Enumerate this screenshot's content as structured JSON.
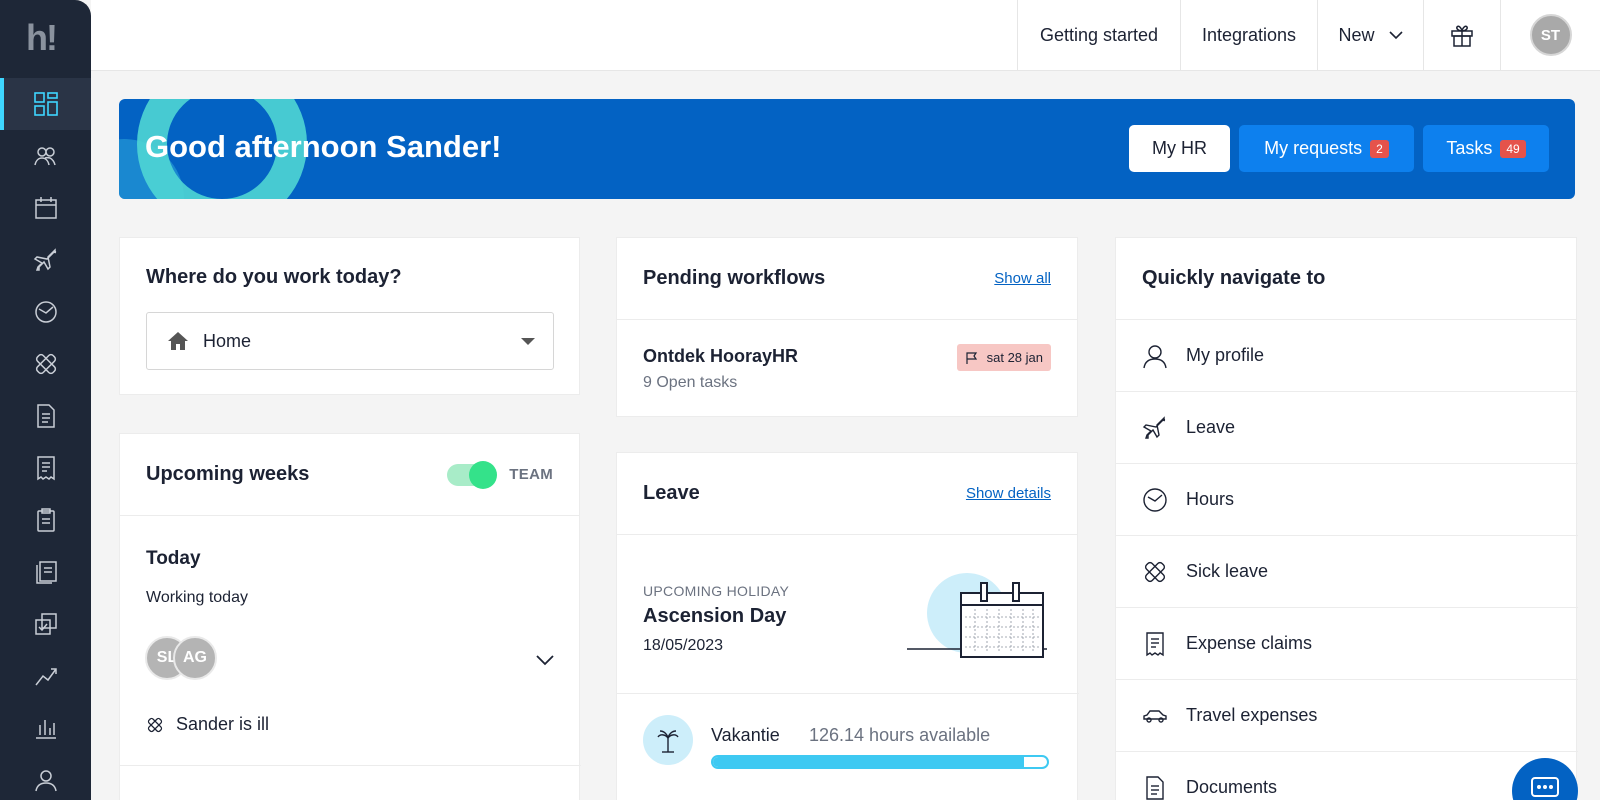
{
  "app": {
    "logo_text": "h!"
  },
  "sidebar": {
    "items": [
      {
        "icon": "dashboard-icon",
        "active": true
      },
      {
        "icon": "people-icon"
      },
      {
        "icon": "calendar-icon"
      },
      {
        "icon": "plane-icon"
      },
      {
        "icon": "clock-icon"
      },
      {
        "icon": "bandage-icon"
      },
      {
        "icon": "document-icon"
      },
      {
        "icon": "receipt-icon"
      },
      {
        "icon": "clipboard-icon"
      },
      {
        "icon": "documents-icon"
      },
      {
        "icon": "checklist-icon"
      },
      {
        "icon": "performance-icon"
      },
      {
        "icon": "bar-chart-icon"
      },
      {
        "icon": "person-icon"
      }
    ]
  },
  "topbar": {
    "getting_started": "Getting started",
    "integrations": "Integrations",
    "new_label": "New",
    "avatar_initials": "ST"
  },
  "banner": {
    "greeting": "Good afternoon Sander!",
    "my_hr": "My HR",
    "my_requests": "My requests",
    "my_requests_count": "2",
    "tasks": "Tasks",
    "tasks_count": "49",
    "colors": {
      "bg": "#0362c3",
      "button": "#0d80ee",
      "badge": "#e5534b"
    }
  },
  "work_location": {
    "title": "Where do you work today?",
    "selected": "Home"
  },
  "upcoming_weeks": {
    "title": "Upcoming weeks",
    "toggle_label": "TEAM",
    "toggle_on": true,
    "today_heading": "Today",
    "working_today": "Working today",
    "avatars": [
      "SL",
      "AG"
    ],
    "status": "Sander is ill"
  },
  "pending_workflows": {
    "title": "Pending workflows",
    "show_all": "Show all",
    "item_title": "Ontdek HoorayHR",
    "item_sub": "9 Open tasks",
    "item_date": "sat 28 jan"
  },
  "leave": {
    "title": "Leave",
    "show_details": "Show details",
    "upcoming_label": "UPCOMING HOLIDAY",
    "holiday_name": "Ascension Day",
    "holiday_date": "18/05/2023",
    "vacation_type": "Vakantie",
    "vacation_hours": "126.14 hours available",
    "vacation_fraction": 0.93
  },
  "quick_nav": {
    "title": "Quickly navigate to",
    "items": [
      {
        "label": "My profile",
        "icon": "person-icon"
      },
      {
        "label": "Leave",
        "icon": "plane-icon"
      },
      {
        "label": "Hours",
        "icon": "clock-icon"
      },
      {
        "label": "Sick leave",
        "icon": "bandage-icon"
      },
      {
        "label": "Expense claims",
        "icon": "receipt-icon"
      },
      {
        "label": "Travel expenses",
        "icon": "car-icon"
      },
      {
        "label": "Documents",
        "icon": "document-icon"
      }
    ]
  }
}
